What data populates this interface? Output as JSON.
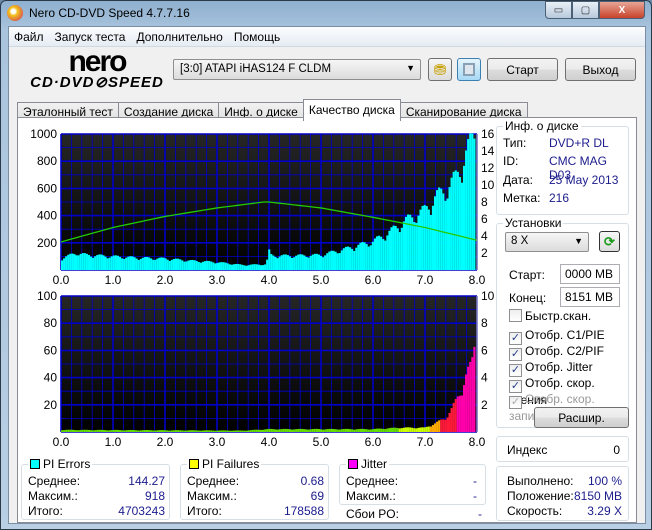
{
  "window": {
    "title": "Nero CD-DVD Speed 4.7.7.16",
    "min": "▭",
    "max": "▢",
    "close": "X"
  },
  "menu": [
    "Файл",
    "Запуск теста",
    "Дополнительно",
    "Помощь"
  ],
  "logo": {
    "top": "nero",
    "bottom": "CD·DVD⊘SPEED"
  },
  "drive": "[3:0]   ATAPI iHAS124   F CLDM",
  "buttons": {
    "start": "Старт",
    "exit": "Выход",
    "advanced": "Расшир."
  },
  "tabs": [
    "Эталонный тест",
    "Создание диска",
    "Инф. о диске",
    "Качество диска",
    "Сканирование диска"
  ],
  "disc_info": {
    "title": "Инф. о диске",
    "type_label": "Тип:",
    "type": "DVD+R DL",
    "id_label": "ID:",
    "id": "CMC MAG D03",
    "date_label": "Дата:",
    "date": "25 May 2013",
    "label_label": "Метка:",
    "label": "216"
  },
  "settings": {
    "title": "Установки",
    "speed": "8 X",
    "start_label": "Старт:",
    "start": "0000 MB",
    "end_label": "Конец:",
    "end": "8151 MB",
    "checks": [
      {
        "label": "Быстр.скан.",
        "checked": false,
        "disabled": false
      },
      {
        "label": "Отобр. C1/PIE",
        "checked": true,
        "disabled": false
      },
      {
        "label": "Отобр. C2/PIF",
        "checked": true,
        "disabled": false
      },
      {
        "label": "Отобр. Jitter",
        "checked": true,
        "disabled": false
      },
      {
        "label": "Отобр. скор. чтения",
        "checked": true,
        "disabled": false
      },
      {
        "label": "Отобр. скор. записи",
        "checked": true,
        "disabled": true
      }
    ]
  },
  "index": {
    "label": "Индекс",
    "value": "0"
  },
  "progress": {
    "done_label": "Выполнено:",
    "done": "100 %",
    "pos_label": "Положение:",
    "pos": "8150 MB",
    "speed_label": "Скорость:",
    "speed": "3.29 X"
  },
  "pi_errors": {
    "title": "PI Errors",
    "color": "#00ffff",
    "avg_label": "Среднее:",
    "avg": "144.27",
    "max_label": "Максим.:",
    "max": "918",
    "total_label": "Итого:",
    "total": "4703243"
  },
  "pi_failures": {
    "title": "PI Failures",
    "color": "#ffff00",
    "avg_label": "Среднее:",
    "avg": "0.68",
    "max_label": "Максим.:",
    "max": "69",
    "total_label": "Итого:",
    "total": "178588"
  },
  "jitter": {
    "title": "Jitter",
    "color": "#ff00ff",
    "avg_label": "Среднее:",
    "avg": "-",
    "max_label": "Максим.:",
    "max": "-",
    "po_label": "Сбои PO:",
    "po": "-"
  },
  "chart_data": [
    {
      "type": "bar",
      "title": "PI Errors / Read speed",
      "xlim": [
        0,
        8
      ],
      "ylim": [
        0,
        1000
      ],
      "y2lim": [
        0,
        16
      ],
      "xticks": [
        "0.0",
        "1.0",
        "2.0",
        "3.0",
        "4.0",
        "5.0",
        "6.0",
        "7.0",
        "8.0"
      ],
      "yticks": [
        "200",
        "400",
        "600",
        "800",
        "1000"
      ],
      "y2ticks": [
        "2",
        "4",
        "6",
        "8",
        "10",
        "12",
        "14",
        "16"
      ],
      "pie": {
        "x": [
          0,
          0.3,
          0.5,
          1,
          1.5,
          2,
          2.5,
          3,
          3.5,
          3.95,
          4.0,
          4.05,
          4.5,
          5,
          5.5,
          6,
          6.3,
          6.6,
          6.9,
          7,
          7.2,
          7.4,
          7.6,
          7.8,
          7.9,
          7.97
        ],
        "y": [
          80,
          120,
          105,
          95,
          85,
          80,
          65,
          55,
          35,
          40,
          135,
          100,
          100,
          105,
          150,
          200,
          260,
          340,
          400,
          420,
          510,
          560,
          650,
          820,
          900,
          980
        ]
      },
      "speed": {
        "x": [
          0,
          1,
          2,
          3,
          3.9,
          4,
          5,
          6,
          7,
          8
        ],
        "y": [
          3.3,
          5,
          6.3,
          7.3,
          8,
          8,
          7.3,
          6.2,
          5,
          3.5
        ]
      }
    },
    {
      "type": "bar",
      "title": "PI Failures",
      "xlim": [
        0,
        8
      ],
      "ylim": [
        0,
        100
      ],
      "y2lim": [
        0,
        10
      ],
      "xticks": [
        "0.0",
        "1.0",
        "2.0",
        "3.0",
        "4.0",
        "5.0",
        "6.0",
        "7.0",
        "8.0"
      ],
      "yticks": [
        "20",
        "40",
        "60",
        "80",
        "100"
      ],
      "y2ticks": [
        "2",
        "4",
        "6",
        "8",
        "10"
      ],
      "pif": {
        "x": [
          0,
          3.5,
          4,
          6,
          6.5,
          7,
          7.2,
          7.4,
          7.5,
          7.6,
          7.7,
          7.8,
          7.9,
          7.97
        ],
        "y": [
          1.5,
          1,
          2,
          2,
          3,
          3,
          6,
          10,
          15,
          22,
          30,
          40,
          47,
          68
        ]
      }
    }
  ]
}
